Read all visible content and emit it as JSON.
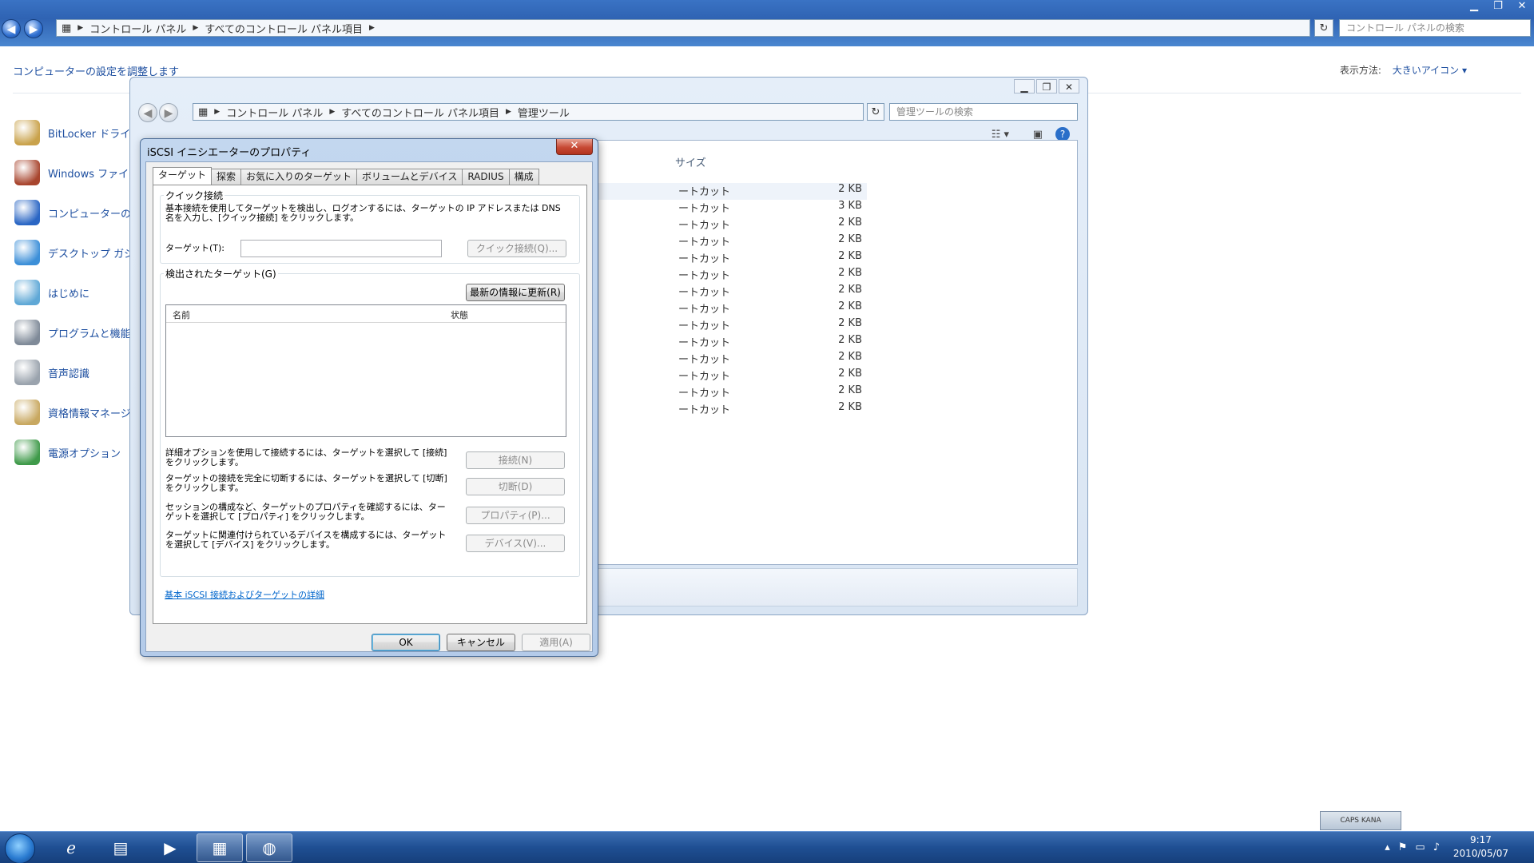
{
  "outer": {
    "breadcrumb": [
      "コントロール パネル",
      "すべてのコントロール パネル項目"
    ],
    "search_placeholder": "コントロール パネルの検索",
    "heading": "コンピューターの設定を調整します",
    "viewby_label": "表示方法:",
    "viewby_value": "大きいアイコン ▾",
    "items": [
      {
        "label": "BitLocker ドライブ",
        "color": "#c9a24b"
      },
      {
        "label": "Windows ファイア",
        "color": "#a8452e"
      },
      {
        "label": "コンピューターの簡",
        "color": "#2a66c4"
      },
      {
        "label": "デスクトップ ガジ",
        "color": "#3c8fd8"
      },
      {
        "label": "はじめに",
        "color": "#5fa8d6"
      },
      {
        "label": "プログラムと機能",
        "color": "#7f8a98"
      },
      {
        "label": "音声認識",
        "color": "#9aa3ad"
      },
      {
        "label": "資格情報マネージ",
        "color": "#c8a860"
      },
      {
        "label": "電源オプション",
        "color": "#3f9a4a"
      }
    ]
  },
  "admin": {
    "breadcrumb": [
      "コントロール パネル",
      "すべてのコントロール パネル項目",
      "管理ツール"
    ],
    "search_placeholder": "管理ツールの検索",
    "size_header": "サイズ",
    "rows": [
      {
        "type": "ートカット",
        "size": "2 KB"
      },
      {
        "type": "ートカット",
        "size": "3 KB"
      },
      {
        "type": "ートカット",
        "size": "2 KB"
      },
      {
        "type": "ートカット",
        "size": "2 KB"
      },
      {
        "type": "ートカット",
        "size": "2 KB"
      },
      {
        "type": "ートカット",
        "size": "2 KB"
      },
      {
        "type": "ートカット",
        "size": "2 KB"
      },
      {
        "type": "ートカット",
        "size": "2 KB"
      },
      {
        "type": "ートカット",
        "size": "2 KB"
      },
      {
        "type": "ートカット",
        "size": "2 KB"
      },
      {
        "type": "ートカット",
        "size": "2 KB"
      },
      {
        "type": "ートカット",
        "size": "2 KB"
      },
      {
        "type": "ートカット",
        "size": "2 KB"
      },
      {
        "type": "ートカット",
        "size": "2 KB"
      }
    ]
  },
  "dialog": {
    "title": "iSCSI イニシエーターのプロパティ",
    "tabs": [
      "ターゲット",
      "探索",
      "お気に入りのターゲット",
      "ボリュームとデバイス",
      "RADIUS",
      "構成"
    ],
    "quick_connect": {
      "title": "クイック接続",
      "desc": "基本接続を使用してターゲットを検出し、ログオンするには、ターゲットの IP アドレスまたは DNS 名を入力し、[クイック接続] をクリックします。",
      "target_label": "ターゲット(T):",
      "target_value": "",
      "quick_button": "クイック接続(Q)..."
    },
    "discovered": {
      "title": "検出されたターゲット(G)",
      "refresh_button": "最新の情報に更新(R)",
      "col_name": "名前",
      "col_status": "状態"
    },
    "actions": [
      {
        "desc": "詳細オプションを使用して接続するには、ターゲットを選択して [接続] をクリックします。",
        "button": "接続(N)"
      },
      {
        "desc": "ターゲットの接続を完全に切断するには、ターゲットを選択して [切断] をクリックします。",
        "button": "切断(D)"
      },
      {
        "desc": "セッションの構成など、ターゲットのプロパティを確認するには、ターゲットを選択して [プロパティ] をクリックします。",
        "button": "プロパティ(P)..."
      },
      {
        "desc": "ターゲットに関連付けられているデバイスを構成するには、ターゲットを選択して [デバイス] をクリックします。",
        "button": "デバイス(V)..."
      }
    ],
    "link": "基本 iSCSI 接続およびターゲットの詳細",
    "ok": "OK",
    "cancel": "キャンセル",
    "apply": "適用(A)"
  },
  "taskbar": {
    "time": "9:17",
    "date": "2010/05/07",
    "langbar": "CAPS KANA"
  }
}
